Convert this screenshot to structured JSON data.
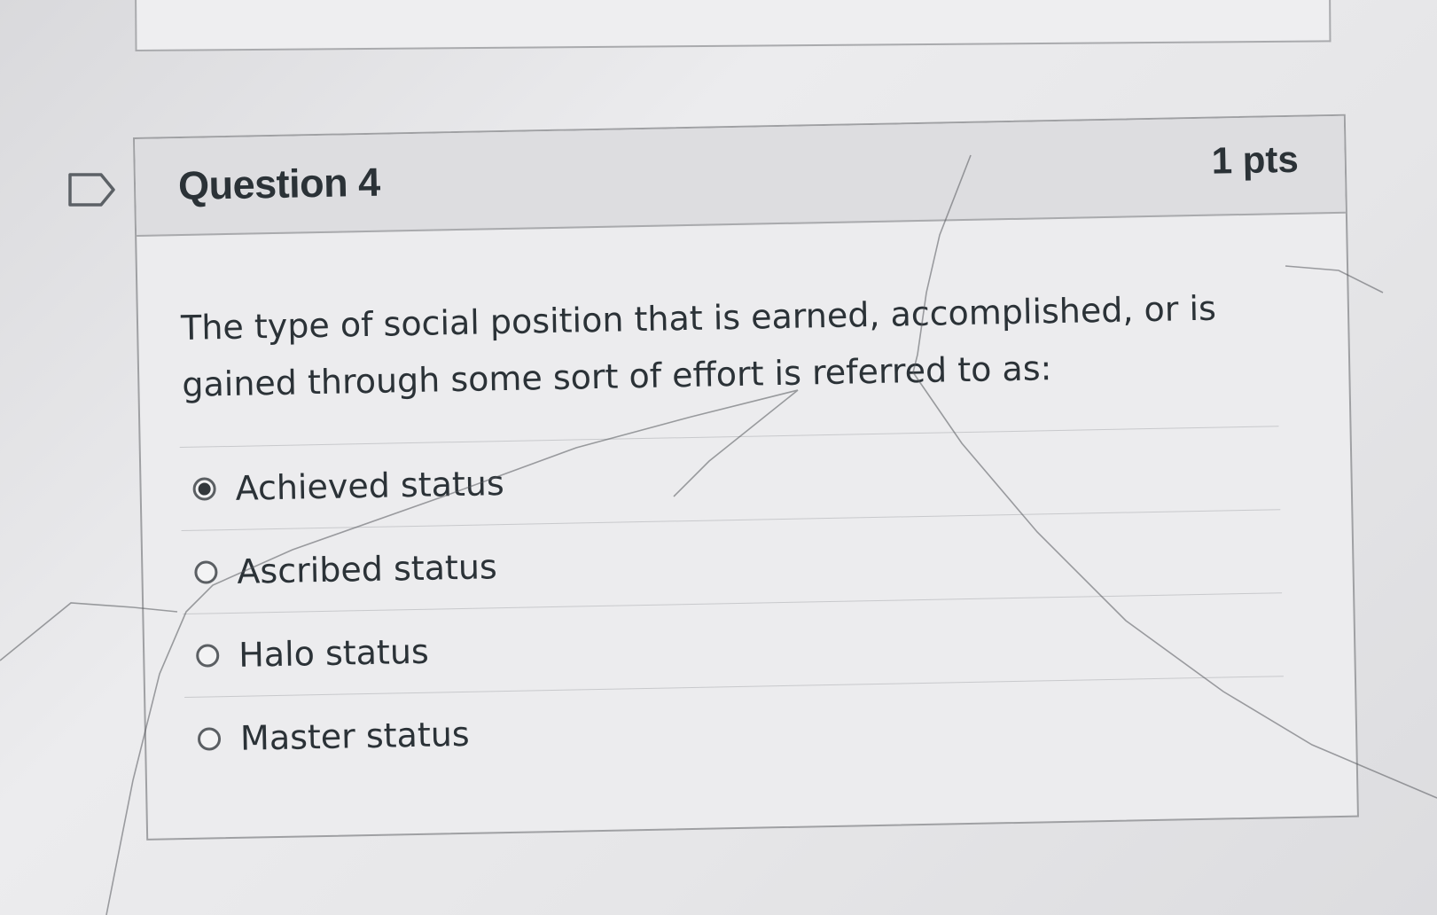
{
  "question": {
    "title": "Question 4",
    "points": "1 pts",
    "text": "The type of social position that is earned, accomplished, or is gained through some sort of effort is referred to as:",
    "flag_icon": "bookmark-flag-icon"
  },
  "answers": [
    {
      "label": "Achieved status",
      "selected": true
    },
    {
      "label": "Ascribed status",
      "selected": false
    },
    {
      "label": "Halo status",
      "selected": false
    },
    {
      "label": "Master status",
      "selected": false
    }
  ],
  "colors": {
    "text": "#2b3237",
    "border": "#9fa0a3",
    "header_bg": "#dddde0",
    "body_bg": "#ececee"
  }
}
